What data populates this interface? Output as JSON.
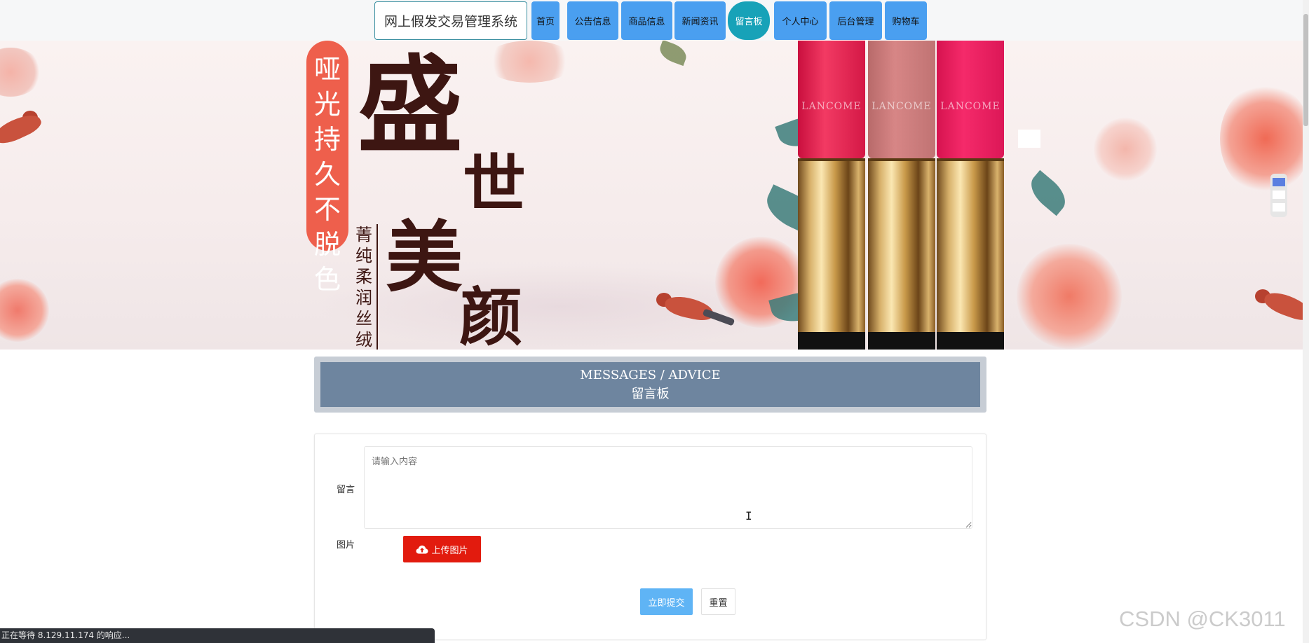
{
  "header": {
    "site_title": "网上假发交易管理系统",
    "nav": [
      {
        "label": "首页",
        "active": false
      },
      {
        "label": "公告信息",
        "active": false
      },
      {
        "label": "商品信息",
        "active": false
      },
      {
        "label": "新闻资讯",
        "active": false
      },
      {
        "label": "留言板",
        "active": true
      },
      {
        "label": "个人中心",
        "active": false
      },
      {
        "label": "后台管理",
        "active": false
      },
      {
        "label": "购物车",
        "active": false
      }
    ]
  },
  "banner": {
    "pill_text": "哑光持久不脱色",
    "headline_1": "盛",
    "headline_2": "世",
    "headline_3": "美",
    "headline_4": "颜",
    "sub_text": "菁纯柔润丝绒",
    "brand": "LANCOME"
  },
  "section": {
    "title_en": "MESSAGES / ADVICE",
    "title_cn": "留言板"
  },
  "form": {
    "message_label": "留言",
    "message_placeholder": "请输入内容",
    "message_value": "",
    "image_label": "图片",
    "upload_label": "上传图片",
    "submit_label": "立即提交",
    "reset_label": "重置"
  },
  "status_bar": "正在等待 8.129.11.174 的响应...",
  "watermark": "CSDN @CK3011",
  "colors": {
    "nav_bg": "#4a9ff0",
    "nav_active": "#17a2b8",
    "upload_btn": "#e21b0e",
    "submit_btn": "#5fb4f5",
    "section_header": "#6e859f"
  },
  "icons": {
    "upload": "cloud-upload-icon"
  }
}
